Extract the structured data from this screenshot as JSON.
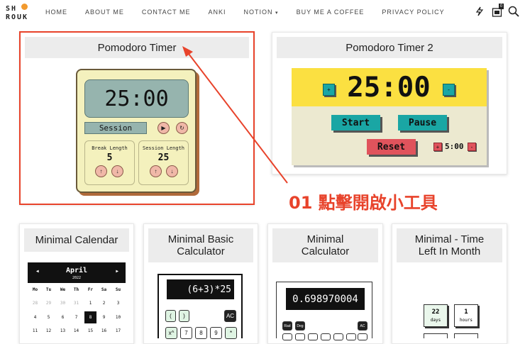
{
  "brand": {
    "logo_text": "SHROUK"
  },
  "nav": {
    "items": [
      "HOME",
      "ABOUT ME",
      "CONTACT ME",
      "ANKI",
      "NOTION",
      "BUY ME A COFFEE",
      "PRIVACY POLICY"
    ],
    "notion_caret": "▾",
    "badge_count": "0"
  },
  "cards": {
    "pomodoro1": {
      "title": "Pomodoro Timer",
      "time": "25:00",
      "mode": "Session",
      "break_label": "Break Length",
      "break_value": "5",
      "session_label": "Session Length",
      "session_value": "25"
    },
    "pomodoro2": {
      "title": "Pomodoro Timer 2",
      "time": "25:00",
      "plus": "+",
      "minus": "-",
      "start": "Start",
      "pause": "Pause",
      "reset": "Reset",
      "break_value": "5:00"
    },
    "calendar": {
      "title": "Minimal Calendar",
      "month": "April",
      "year": "2022",
      "prev": "◀",
      "next": "▶",
      "weekdays": [
        "Mo",
        "Tu",
        "We",
        "Th",
        "Fr",
        "Sa",
        "Su"
      ],
      "row1": [
        "28",
        "29",
        "30",
        "31",
        "1",
        "2",
        "3"
      ],
      "row2": [
        "4",
        "5",
        "6",
        "7",
        "8",
        "9",
        "10"
      ],
      "row3": [
        "11",
        "12",
        "13",
        "14",
        "15",
        "16",
        "17"
      ],
      "today": "8"
    },
    "basic_calc": {
      "title_line1": "Minimal Basic",
      "title_line2": "Calculator",
      "display": "(6+3)*25",
      "keys": [
        "(",
        ")",
        "AC",
        "x^",
        "7",
        "8",
        "9",
        "*"
      ]
    },
    "calc": {
      "title_line1": "Minimal",
      "title_line2": "Calculator",
      "display": "0.698970004",
      "keys": [
        "Rad",
        "Deg",
        "AC"
      ]
    },
    "time_left": {
      "title_line1": "Minimal - Time",
      "title_line2": "Left In Month",
      "days_value": "22",
      "days_label": "days",
      "hours_value": "1",
      "hours_label": "hours"
    }
  },
  "annotation": {
    "text": "01 點擊開啟小工具",
    "color": "#e8432b"
  }
}
